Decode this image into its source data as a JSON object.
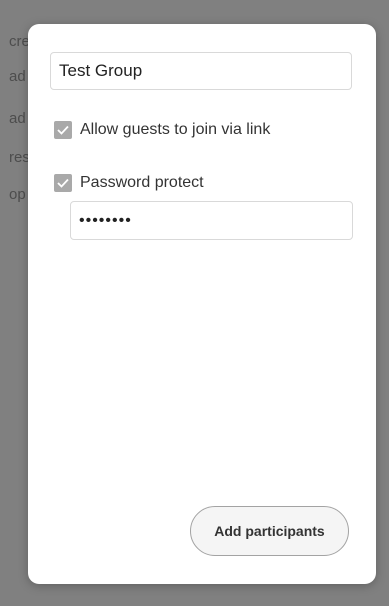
{
  "background": {
    "fragments": [
      "cre",
      "ad",
      "ad",
      "res",
      "op"
    ]
  },
  "dialog": {
    "group_name_value": "Test Group",
    "allow_guests": {
      "label": "Allow guests to join via link",
      "checked": true
    },
    "password_protect": {
      "label": "Password protect",
      "checked": true
    },
    "password_value": "password",
    "add_participants_label": "Add participants"
  },
  "colors": {
    "checkbox_fill": "#a9a9a9",
    "overlay": "#808080"
  }
}
